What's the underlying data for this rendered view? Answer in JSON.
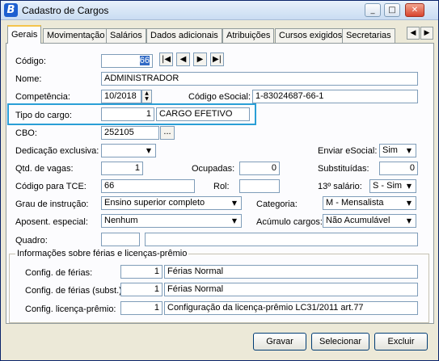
{
  "window": {
    "title": "Cadastro de Cargos",
    "minimize": "_",
    "maximize": "□",
    "close": "✕"
  },
  "tabs": [
    "Gerais",
    "Movimentação",
    "Salários",
    "Dados adicionais",
    "Atribuições",
    "Cursos exigidos",
    "Secretarias"
  ],
  "tab_scroll": {
    "left": "◀",
    "right": "▶"
  },
  "nav": {
    "first": "|◀",
    "prev": "◀",
    "next": "▶",
    "last": "▶|"
  },
  "form": {
    "codigo_label": "Código:",
    "codigo_value": "66",
    "nome_label": "Nome:",
    "nome_value": "ADMINISTRADOR",
    "competencia_label": "Competência:",
    "competencia_value": "10/2018",
    "codigo_esocial_label": "Código eSocial:",
    "codigo_esocial_value": "1-83024687-66-1",
    "tipo_label": "Tipo do cargo:",
    "tipo_code": "1",
    "tipo_desc": "CARGO EFETIVO",
    "cbo_label": "CBO:",
    "cbo_value": "252105",
    "dots": "...",
    "dedicacao_label": "Dedicação exclusiva:",
    "dedicacao_value": "",
    "enviar_label": "Enviar eSocial:",
    "enviar_value": "Sim",
    "vagas_label": "Qtd. de vagas:",
    "vagas_value": "1",
    "ocupadas_label": "Ocupadas:",
    "ocupadas_value": "0",
    "substituidas_label": "Substituídas:",
    "substituidas_value": "0",
    "tce_label": "Código para TCE:",
    "tce_value": "66",
    "rol_label": "Rol:",
    "rol_value": "",
    "decimo_label": "13º salário:",
    "decimo_value": "S - Sim",
    "grau_label": "Grau de instrução:",
    "grau_value": "Ensino superior completo",
    "categoria_label": "Categoria:",
    "categoria_value": "M - Mensalista",
    "aposent_label": "Aposent. especial:",
    "aposent_value": "Nenhum",
    "acumulo_label": "Acúmulo cargos:",
    "acumulo_value": "Não Acumulável",
    "quadro_label": "Quadro:",
    "quadro_value": "",
    "quadro_desc": ""
  },
  "group": {
    "title": "Informações sobre férias e licenças-prêmio",
    "ferias_label": "Config. de férias:",
    "ferias_code": "1",
    "ferias_desc": "Férias Normal",
    "ferias_subst_label": "Config. de férias (subst.):",
    "ferias_subst_code": "1",
    "ferias_subst_desc": "Férias Normal",
    "licenca_label": "Config. licença-prêmio:",
    "licenca_code": "1",
    "licenca_desc": "Configuração da licença-prêmio LC31/2011 art.77"
  },
  "buttons": {
    "gravar": "Gravar",
    "selecionar": "Selecionar",
    "excluir": "Excluir"
  }
}
